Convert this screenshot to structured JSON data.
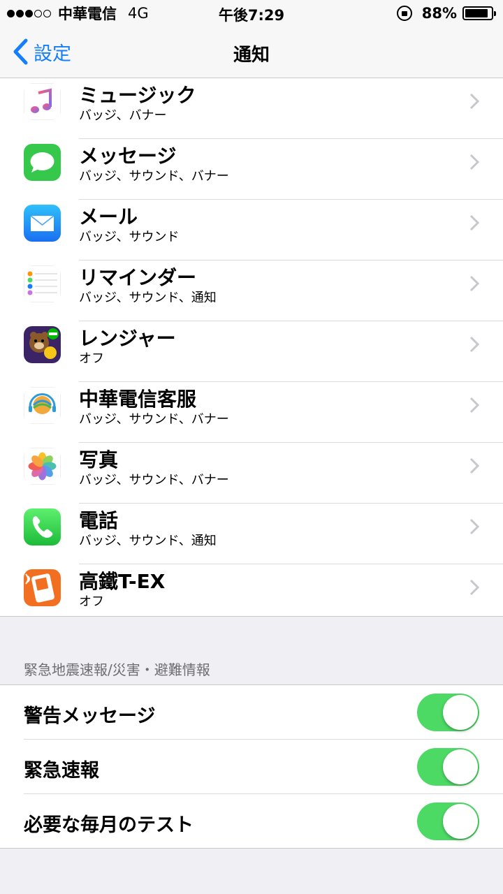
{
  "status_bar": {
    "carrier": "中華電信",
    "network": "4G",
    "time": "午後7:29",
    "battery": "88%",
    "battery_level": 0.88,
    "signal_dots": [
      true,
      true,
      true,
      false,
      false
    ]
  },
  "nav": {
    "back_label": "設定",
    "title": "通知"
  },
  "apps": [
    {
      "name": "ミュージック",
      "subtitle": "バッジ、バナー",
      "icon": "music-icon"
    },
    {
      "name": "メッセージ",
      "subtitle": "バッジ、サウンド、バナー",
      "icon": "messages-icon"
    },
    {
      "name": "メール",
      "subtitle": "バッジ、サウンド",
      "icon": "mail-icon"
    },
    {
      "name": "リマインダー",
      "subtitle": "バッジ、サウンド、通知",
      "icon": "reminders-icon"
    },
    {
      "name": "レンジャー",
      "subtitle": "オフ",
      "icon": "line-ranger-icon"
    },
    {
      "name": "中華電信客服",
      "subtitle": "バッジ、サウンド、バナー",
      "icon": "cht-service-icon"
    },
    {
      "name": "写真",
      "subtitle": "バッジ、サウンド、バナー",
      "icon": "photos-icon"
    },
    {
      "name": "電話",
      "subtitle": "バッジ、サウンド、通知",
      "icon": "phone-icon"
    },
    {
      "name": "高鐵T-EX",
      "subtitle": "オフ",
      "icon": "thsr-tex-icon"
    }
  ],
  "emergency_section": {
    "header": "緊急地震速報/災害・避難情報",
    "toggles": [
      {
        "label": "警告メッセージ",
        "on": true
      },
      {
        "label": "緊急速報",
        "on": true
      },
      {
        "label": "必要な毎月のテスト",
        "on": true
      }
    ]
  },
  "colors": {
    "accent": "#147efb",
    "toggle_on": "#4cd964"
  }
}
